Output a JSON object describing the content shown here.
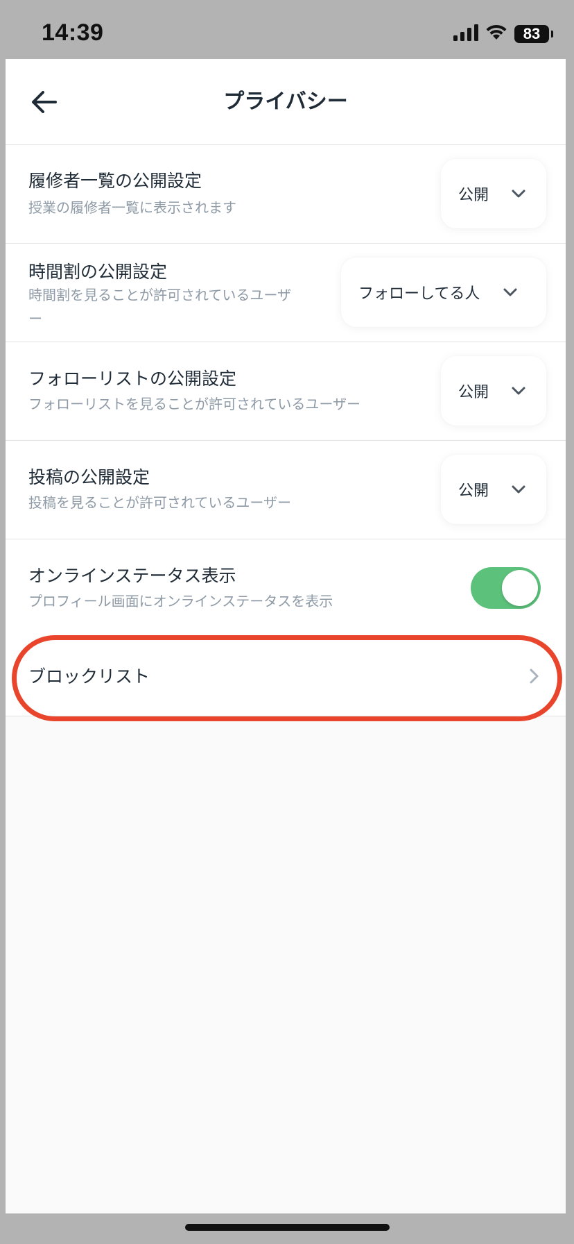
{
  "status_bar": {
    "time": "14:39",
    "battery_level": "83"
  },
  "nav": {
    "title": "プライバシー",
    "back_icon": "arrow-left-icon"
  },
  "settings": {
    "roster": {
      "title": "履修者一覧の公開設定",
      "description": "授業の履修者一覧に表示されます",
      "value": "公開"
    },
    "timetable": {
      "title": "時間割の公開設定",
      "description_line1": "時間割を見ることが許可されているユーザ",
      "description_line2": "ー",
      "value": "フォローしてる人"
    },
    "follow_list": {
      "title": "フォローリストの公開設定",
      "description": "フォローリストを見ることが許可されているユーザー",
      "value": "公開"
    },
    "posts": {
      "title": "投稿の公開設定",
      "description": "投稿を見ることが許可されているユーザー",
      "value": "公開"
    },
    "online_status": {
      "title": "オンラインステータス表示",
      "description": "プロフィール画面にオンラインステータスを表示",
      "enabled": true
    },
    "block_list": {
      "title": "ブロックリスト"
    }
  },
  "colors": {
    "toggle_on": "#5cc27b",
    "highlight": "#e8452c",
    "text_primary": "#1f2b36",
    "text_secondary": "#8e9aa6"
  }
}
